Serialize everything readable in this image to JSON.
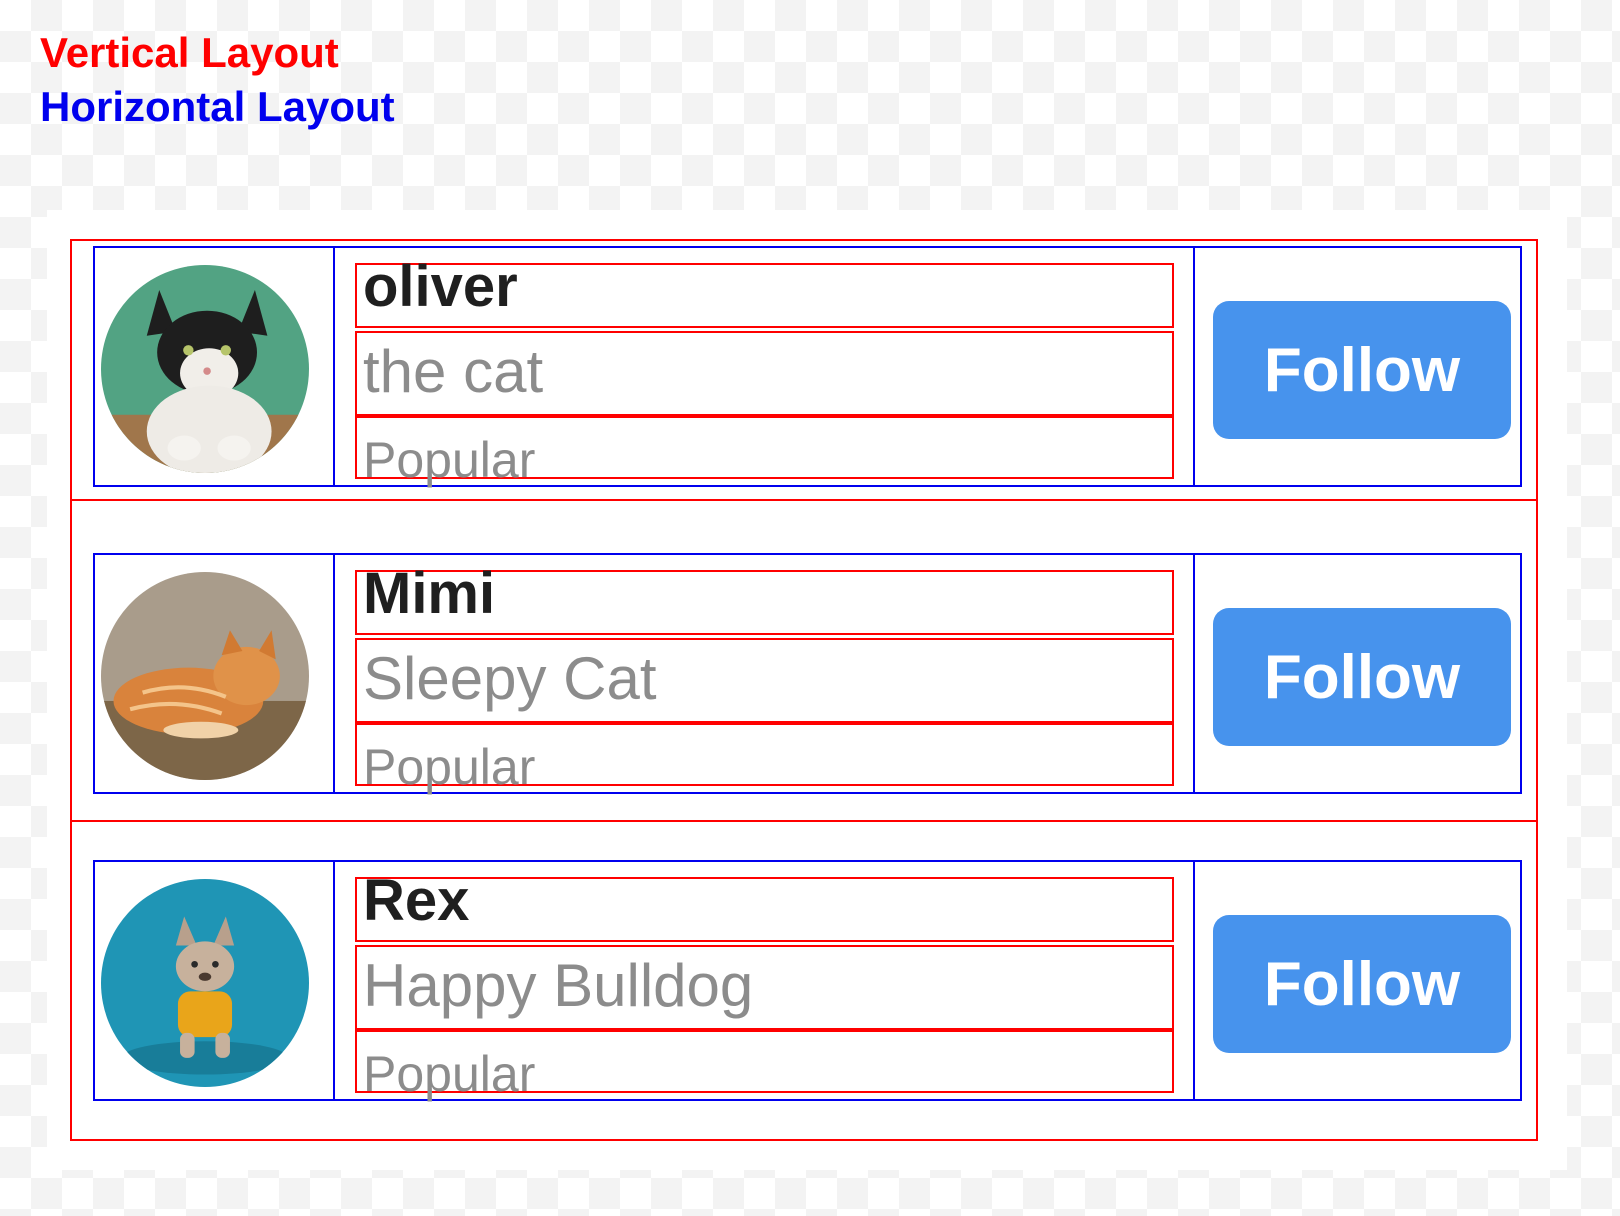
{
  "legend": {
    "vertical": "Vertical Layout",
    "horizontal": "Horizontal Layout",
    "vertical_color": "#ff0000",
    "horizontal_color": "#0000ee"
  },
  "accent": "#4793ed",
  "cards": [
    {
      "name": "oliver",
      "subtitle": "the cat",
      "tag": "Popular",
      "button": "Follow",
      "avatar": "black-white-cat-photo"
    },
    {
      "name": "Mimi",
      "subtitle": "Sleepy Cat",
      "tag": "Popular",
      "button": "Follow",
      "avatar": "orange-tabby-cat-photo"
    },
    {
      "name": "Rex",
      "subtitle": "Happy Bulldog",
      "tag": "Popular",
      "button": "Follow",
      "avatar": "french-bulldog-photo"
    }
  ]
}
